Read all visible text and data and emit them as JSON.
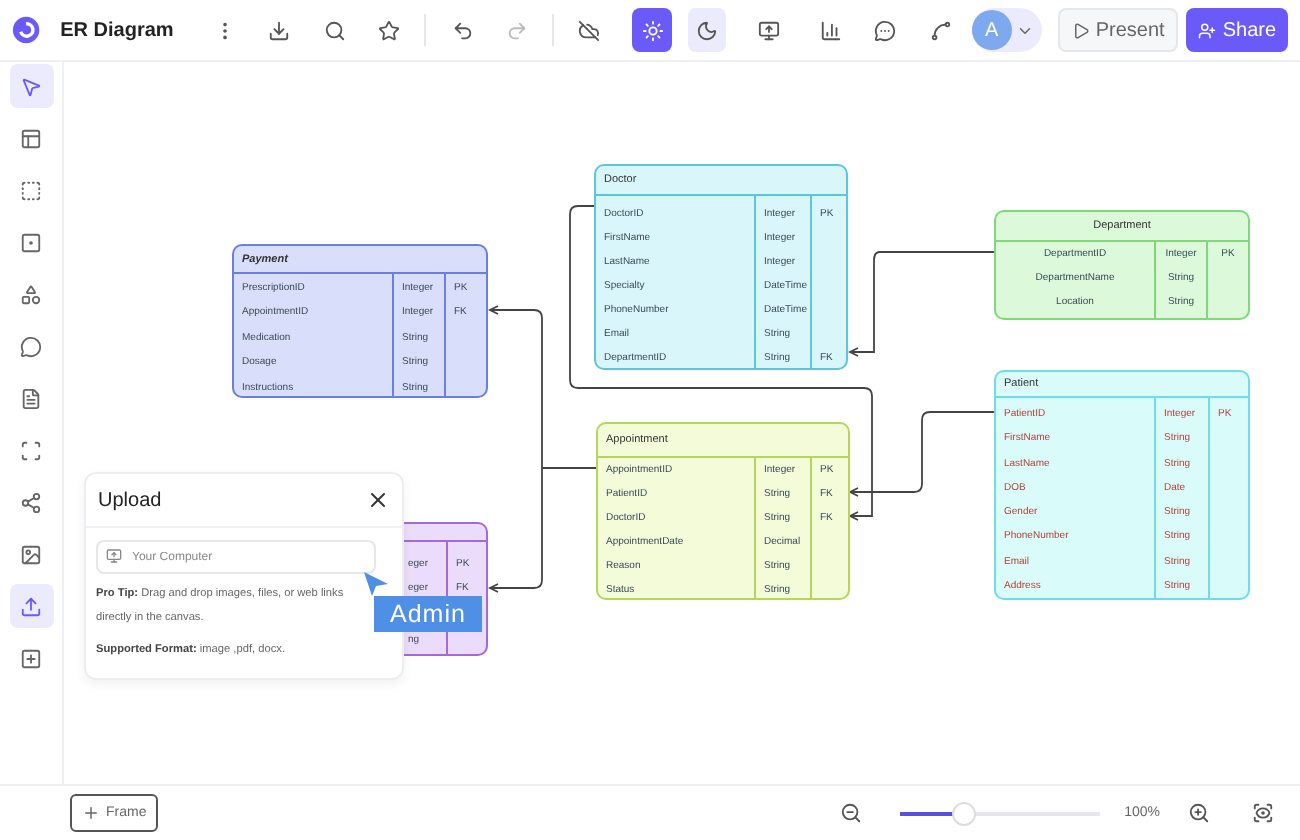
{
  "toolbar": {
    "title": "ER Diagram",
    "theme_toggle": [
      {
        "selected": true
      },
      {
        "selected": false
      }
    ],
    "avatar": "A",
    "buttons": [
      "Present",
      "Share"
    ]
  },
  "sidebar": {
    "items": [
      {
        "selected": true
      },
      {
        "selected": false
      },
      {
        "selected": false
      },
      {
        "selected": false
      },
      {
        "selected": false
      },
      {
        "selected": false
      },
      {
        "selected": false
      },
      {
        "selected": false
      },
      {
        "selected": false
      },
      {
        "selected": false
      },
      {
        "selected": true
      },
      {
        "selected": false
      }
    ]
  },
  "tables": [
    {
      "name": "Payment",
      "kind": "plain",
      "title_bold": true,
      "color": "#d9defb",
      "rows": [
        {
          "field": "PrescriptionID",
          "type": "Integer",
          "key": "PK"
        },
        {
          "field": "AppointmentID",
          "type": "Integer",
          "key": "FK"
        },
        {
          "field": "Medication",
          "type": "String"
        },
        {
          "field": "Dosage",
          "type": "String"
        },
        {
          "field": "Instructions",
          "type": "String"
        }
      ]
    },
    {
      "name": "Doctor",
      "kind": "plain",
      "color": "#d9f7fb",
      "rows": [
        {
          "field": "DoctorID",
          "type": "Integer",
          "key": "PK"
        },
        {
          "field": "FirstName",
          "type": "Integer"
        },
        {
          "field": "LastName",
          "type": "Integer"
        },
        {
          "field": "Specialty",
          "type": "DateTime"
        },
        {
          "field": "PhoneNumber",
          "type": "DateTime"
        },
        {
          "field": "Email",
          "type": "String"
        },
        {
          "field": "DepartmentID",
          "type": "String",
          "key": "FK"
        }
      ]
    },
    {
      "name": "Department",
      "kind": "plain",
      "color": "#dcf9da",
      "rows": [
        {
          "field": "DepartmentID",
          "type": "Integer",
          "key": "PK"
        },
        {
          "field": "DepartmentName",
          "type": "String"
        },
        {
          "field": "Location",
          "type": "String"
        }
      ]
    },
    {
      "kind": "plain",
      "color": "#ecdcfb",
      "rows": [
        {
          "type": "eger",
          "key": "PK"
        },
        {
          "type": "eger",
          "key": "FK"
        },
        {
          "type": "ng"
        }
      ]
    },
    {
      "name": "Appointment",
      "kind": "plain",
      "color": "#f4fbd8",
      "rows": [
        {
          "field": "AppointmentID",
          "type": "Integer",
          "key": "PK"
        },
        {
          "field": "PatientID",
          "type": "String",
          "key": "FK"
        },
        {
          "field": "DoctorID",
          "type": "String",
          "key": "FK"
        },
        {
          "field": "AppointmentDate",
          "type": "Decimal"
        },
        {
          "field": "Reason",
          "type": "String"
        },
        {
          "field": "Status",
          "type": "String"
        }
      ]
    },
    {
      "name": "Patient",
      "kind": "accent",
      "color": "#d9fbfa",
      "rows": [
        {
          "field": "PatientID",
          "type": "Integer",
          "key": "PK"
        },
        {
          "field": "FirstName",
          "type": "String"
        },
        {
          "field": "LastName",
          "type": "String"
        },
        {
          "field": "DOB",
          "type": "Date"
        },
        {
          "field": "Gender",
          "type": "String"
        },
        {
          "field": "PhoneNumber",
          "type": "String"
        },
        {
          "field": "Email",
          "type": "String"
        },
        {
          "field": "Address",
          "type": "String"
        }
      ]
    }
  ],
  "upload": {
    "title": "Upload",
    "field_placeholder": "Your Computer",
    "tip": "**Pro Tip:** Drag and drop images, files, or web links directly in the canvas.",
    "formats": "**Supported Format:** image ,pdf, docx."
  },
  "cursor": {
    "label": "Admin"
  },
  "bottom": {
    "frame_button": "Frame",
    "zoom": {
      "level": 0.32,
      "reading": "100%"
    }
  }
}
